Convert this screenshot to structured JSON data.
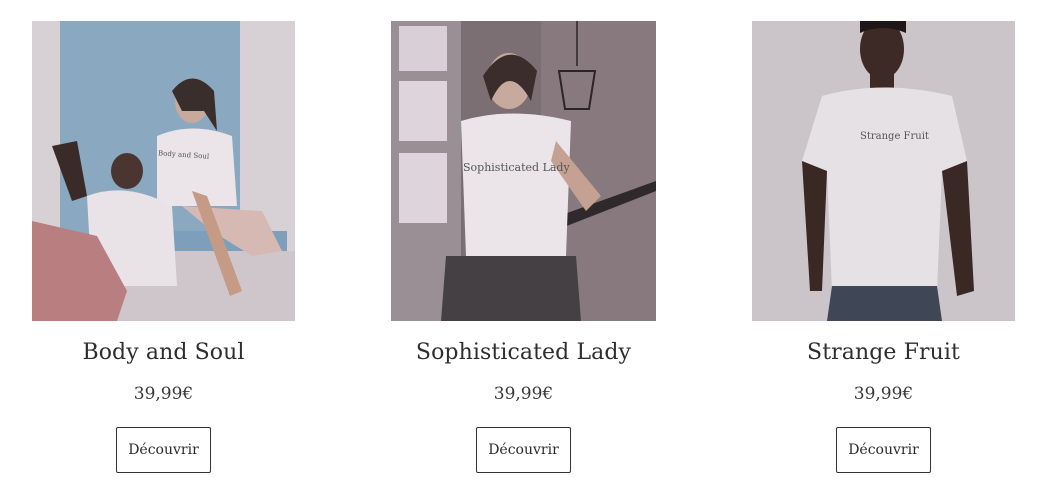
{
  "products": [
    {
      "title": "Body and Soul",
      "price": "39,99€",
      "cta": "Découvrir",
      "shirt_text": "Body and Soul",
      "image": "two-models-photo"
    },
    {
      "title": "Sophisticated Lady",
      "price": "39,99€",
      "cta": "Découvrir",
      "shirt_text": "Sophisticated Lady",
      "image": "woman-model-photo"
    },
    {
      "title": "Strange Fruit",
      "price": "39,99€",
      "cta": "Découvrir",
      "shirt_text": "Strange Fruit",
      "image": "man-model-photo"
    }
  ],
  "colors": {
    "text": "#2e2e2e",
    "button_border": "#333333",
    "background": "#ffffff"
  }
}
